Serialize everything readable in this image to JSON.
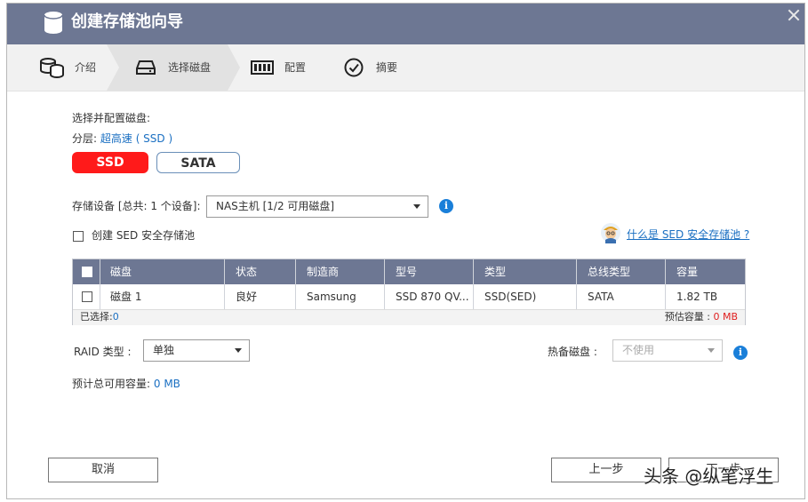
{
  "window": {
    "title": "创建存储池向导"
  },
  "steps": [
    {
      "label": "介绍",
      "icon": "database-icon"
    },
    {
      "label": "选择磁盘",
      "icon": "drive-icon",
      "active": true
    },
    {
      "label": "配置",
      "icon": "raid-icon"
    },
    {
      "label": "摘要",
      "icon": "check-circle-icon"
    }
  ],
  "section": {
    "heading": "选择并配置磁盘:",
    "tier_label": "分层:",
    "tier_value": "超高速 ( SSD )"
  },
  "disk_type_buttons": {
    "ssd": "SSD",
    "sata": "SATA"
  },
  "storage_device": {
    "label": "存储设备 [总共: 1 个设备]:",
    "selected": "NAS主机 [1/2 可用磁盘]"
  },
  "sed": {
    "checkbox_label": "创建 SED 安全存储池",
    "help_link": "什么是 SED 安全存储池 ?"
  },
  "table": {
    "columns": [
      "磁盘",
      "状态",
      "制造商",
      "型号",
      "类型",
      "总线类型",
      "容量"
    ],
    "rows": [
      [
        "磁盘 1",
        "良好",
        "Samsung",
        "SSD 870 QV...",
        "SSD(SED)",
        "SATA",
        "1.82 TB"
      ]
    ],
    "selected_label": "已选择:",
    "selected_count": "0",
    "estimated_label": "预估容量 :",
    "estimated_value": "0 MB"
  },
  "raid": {
    "label": "RAID 类型 :",
    "selected": "单独"
  },
  "hot_spare": {
    "label": "热备磁盘 :",
    "selected": "不使用"
  },
  "total": {
    "label": "预计总可用容量:",
    "value": "0 MB"
  },
  "footer": {
    "cancel": "取消",
    "prev": "上一步",
    "next": "下一步"
  },
  "watermark": "头条 @纵笔浮生",
  "colors": {
    "titlebar": "#6d7793",
    "accent_red": "#ff1a1a",
    "link_blue": "#1a6fc2",
    "info_blue": "#1a7fd9"
  }
}
